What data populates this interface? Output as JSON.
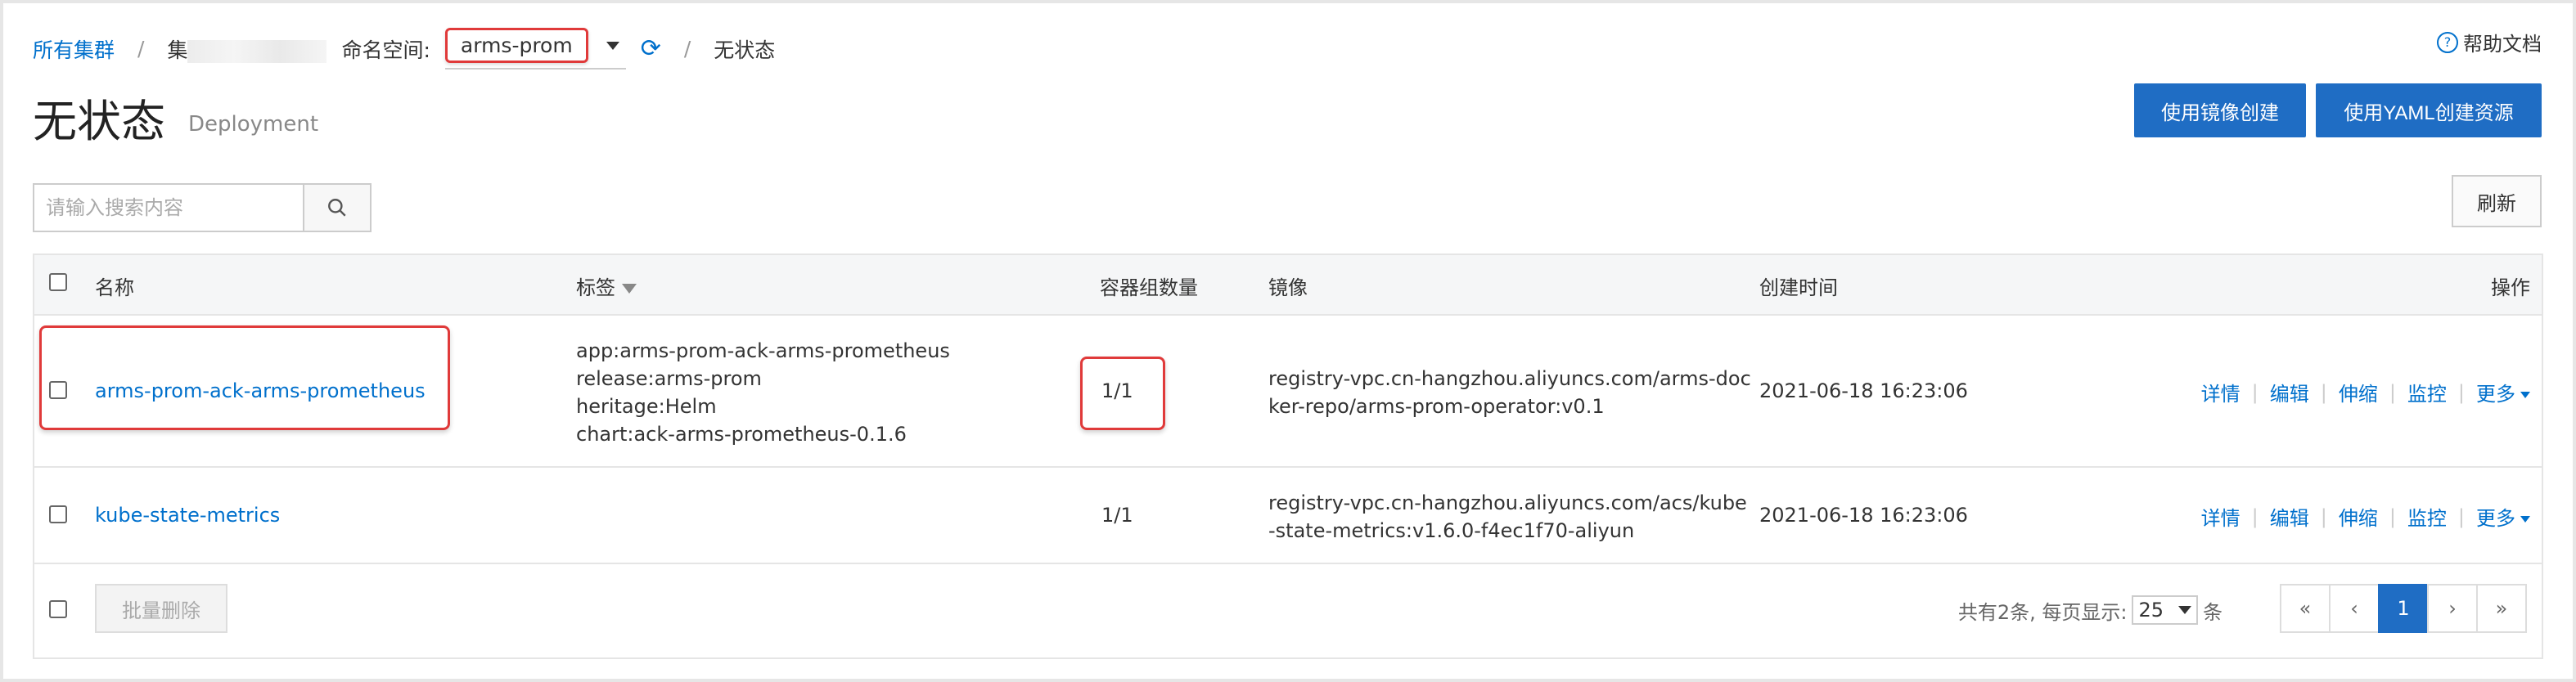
{
  "breadcrumb": {
    "all_clusters": "所有集群",
    "cluster_prefix": "集",
    "namespace_label": "命名空间:",
    "namespace_value": "arms-prom",
    "current": "无状态"
  },
  "help_label": "帮助文档",
  "page": {
    "title": "无状态",
    "subtitle": "Deployment"
  },
  "buttons": {
    "create_by_image": "使用镜像创建",
    "create_by_yaml": "使用YAML创建资源",
    "refresh": "刷新",
    "batch_delete": "批量删除"
  },
  "search": {
    "placeholder": "请输入搜索内容"
  },
  "table": {
    "headers": {
      "name": "名称",
      "labels": "标签",
      "pods": "容器组数量",
      "image": "镜像",
      "created": "创建时间",
      "actions": "操作"
    },
    "rows": [
      {
        "name": "arms-prom-ack-arms-prometheus",
        "labels": [
          "app:arms-prom-ack-arms-prometheus",
          "release:arms-prom",
          "heritage:Helm",
          "chart:ack-arms-prometheus-0.1.6"
        ],
        "pods": "1/1",
        "image": [
          "registry-vpc.cn-hangzhou.aliyuncs.com/arms-doc",
          "ker-repo/arms-prom-operator:v0.1"
        ],
        "created": "2021-06-18 16:23:06"
      },
      {
        "name": "kube-state-metrics",
        "labels": [],
        "pods": "1/1",
        "image": [
          "registry-vpc.cn-hangzhou.aliyuncs.com/acs/kube",
          "-state-metrics:v1.6.0-f4ec1f70-aliyun"
        ],
        "created": "2021-06-18 16:23:06"
      }
    ],
    "actions": {
      "details": "详情",
      "edit": "编辑",
      "scale": "伸缩",
      "monitor": "监控",
      "more": "更多"
    }
  },
  "pagination": {
    "summary": "共有2条, 每页显示:",
    "page_size": "25",
    "unit": "条",
    "first": "«",
    "prev": "‹",
    "current": "1",
    "next": "›",
    "last": "»"
  }
}
